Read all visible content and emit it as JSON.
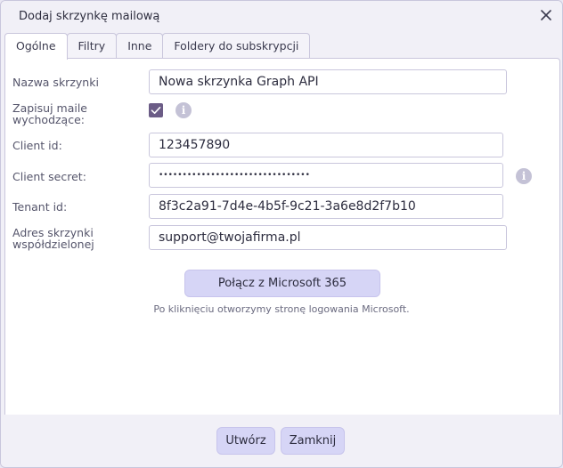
{
  "dialog": {
    "title": "Dodaj skrzynkę mailową",
    "close_icon": "close-icon"
  },
  "tabs": [
    {
      "label": "Ogólne",
      "active": true
    },
    {
      "label": "Filtry",
      "active": false
    },
    {
      "label": "Inne",
      "active": false
    },
    {
      "label": "Foldery do subskrypcji",
      "active": false
    }
  ],
  "form": {
    "mailbox_name_label": "Nazwa skrzynki",
    "mailbox_name_value": "Nowa skrzynka Graph API",
    "save_outgoing_label": "Zapisuj maile wychodzące:",
    "save_outgoing_checked": true,
    "client_id_label": "Client id:",
    "client_id_value": "123457890",
    "client_secret_label": "Client secret:",
    "client_secret_value": "••••••••••••••••••••••••••••••••",
    "tenant_id_label": "Tenant id:",
    "tenant_id_value": "8f3c2a91-7d4e-4b5f-9c21-3a6e8d2f7b10",
    "shared_mailbox_label": "Adres skrzynki współdzielonej",
    "shared_mailbox_value": "support@twojafirma.pl",
    "info_icon": "info-icon"
  },
  "connect": {
    "button_label": "Połącz z Microsoft 365",
    "hint": "Po kliknięciu otworzymy stronę logowania Microsoft."
  },
  "footer": {
    "create_label": "Utwórz",
    "close_label": "Zamknij"
  },
  "colors": {
    "accent": "#6b5c86",
    "button_bg": "#d6d5f6",
    "panel_border": "#c9c6dc"
  }
}
